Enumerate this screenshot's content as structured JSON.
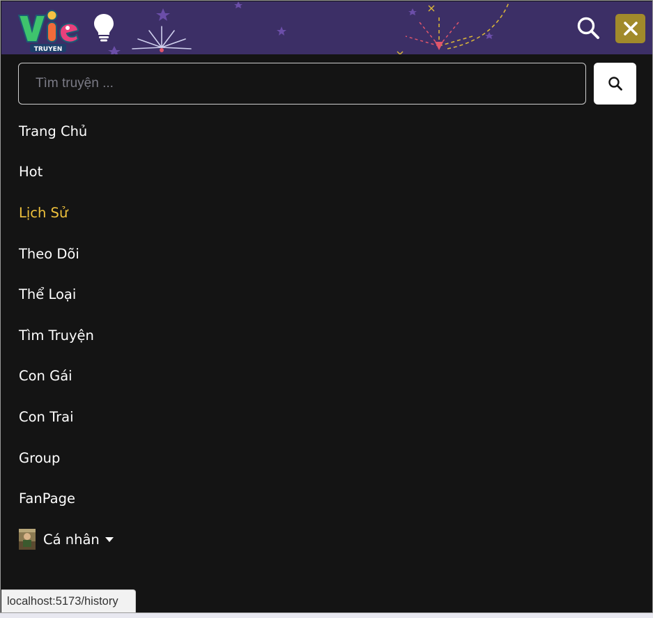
{
  "header": {
    "logo_text": "VIE",
    "logo_subtext": "TRUYEN",
    "icons": [
      "lightbulb-icon",
      "search-icon",
      "close-icon"
    ],
    "colors": {
      "header_bg": "#3c2f66",
      "close_bg": "#a18a2b",
      "accent": "#f0c23c",
      "panel_bg": "#141414"
    }
  },
  "search": {
    "placeholder": "Tìm truyện ...",
    "value": ""
  },
  "menu": {
    "items": [
      {
        "label": "Trang Chủ"
      },
      {
        "label": "Hot"
      },
      {
        "label": "Lịch Sử",
        "active": true
      },
      {
        "label": "Theo Dõi"
      },
      {
        "label": "Thể Loại"
      },
      {
        "label": "Tìm Truyện"
      },
      {
        "label": "Con Gái"
      },
      {
        "label": "Con Trai"
      },
      {
        "label": "Group"
      },
      {
        "label": "FanPage"
      }
    ],
    "account": {
      "label": "Cá nhân",
      "icons": [
        "avatar",
        "caret-down-icon"
      ]
    }
  },
  "status_bar": {
    "url": "localhost:5173/history"
  }
}
